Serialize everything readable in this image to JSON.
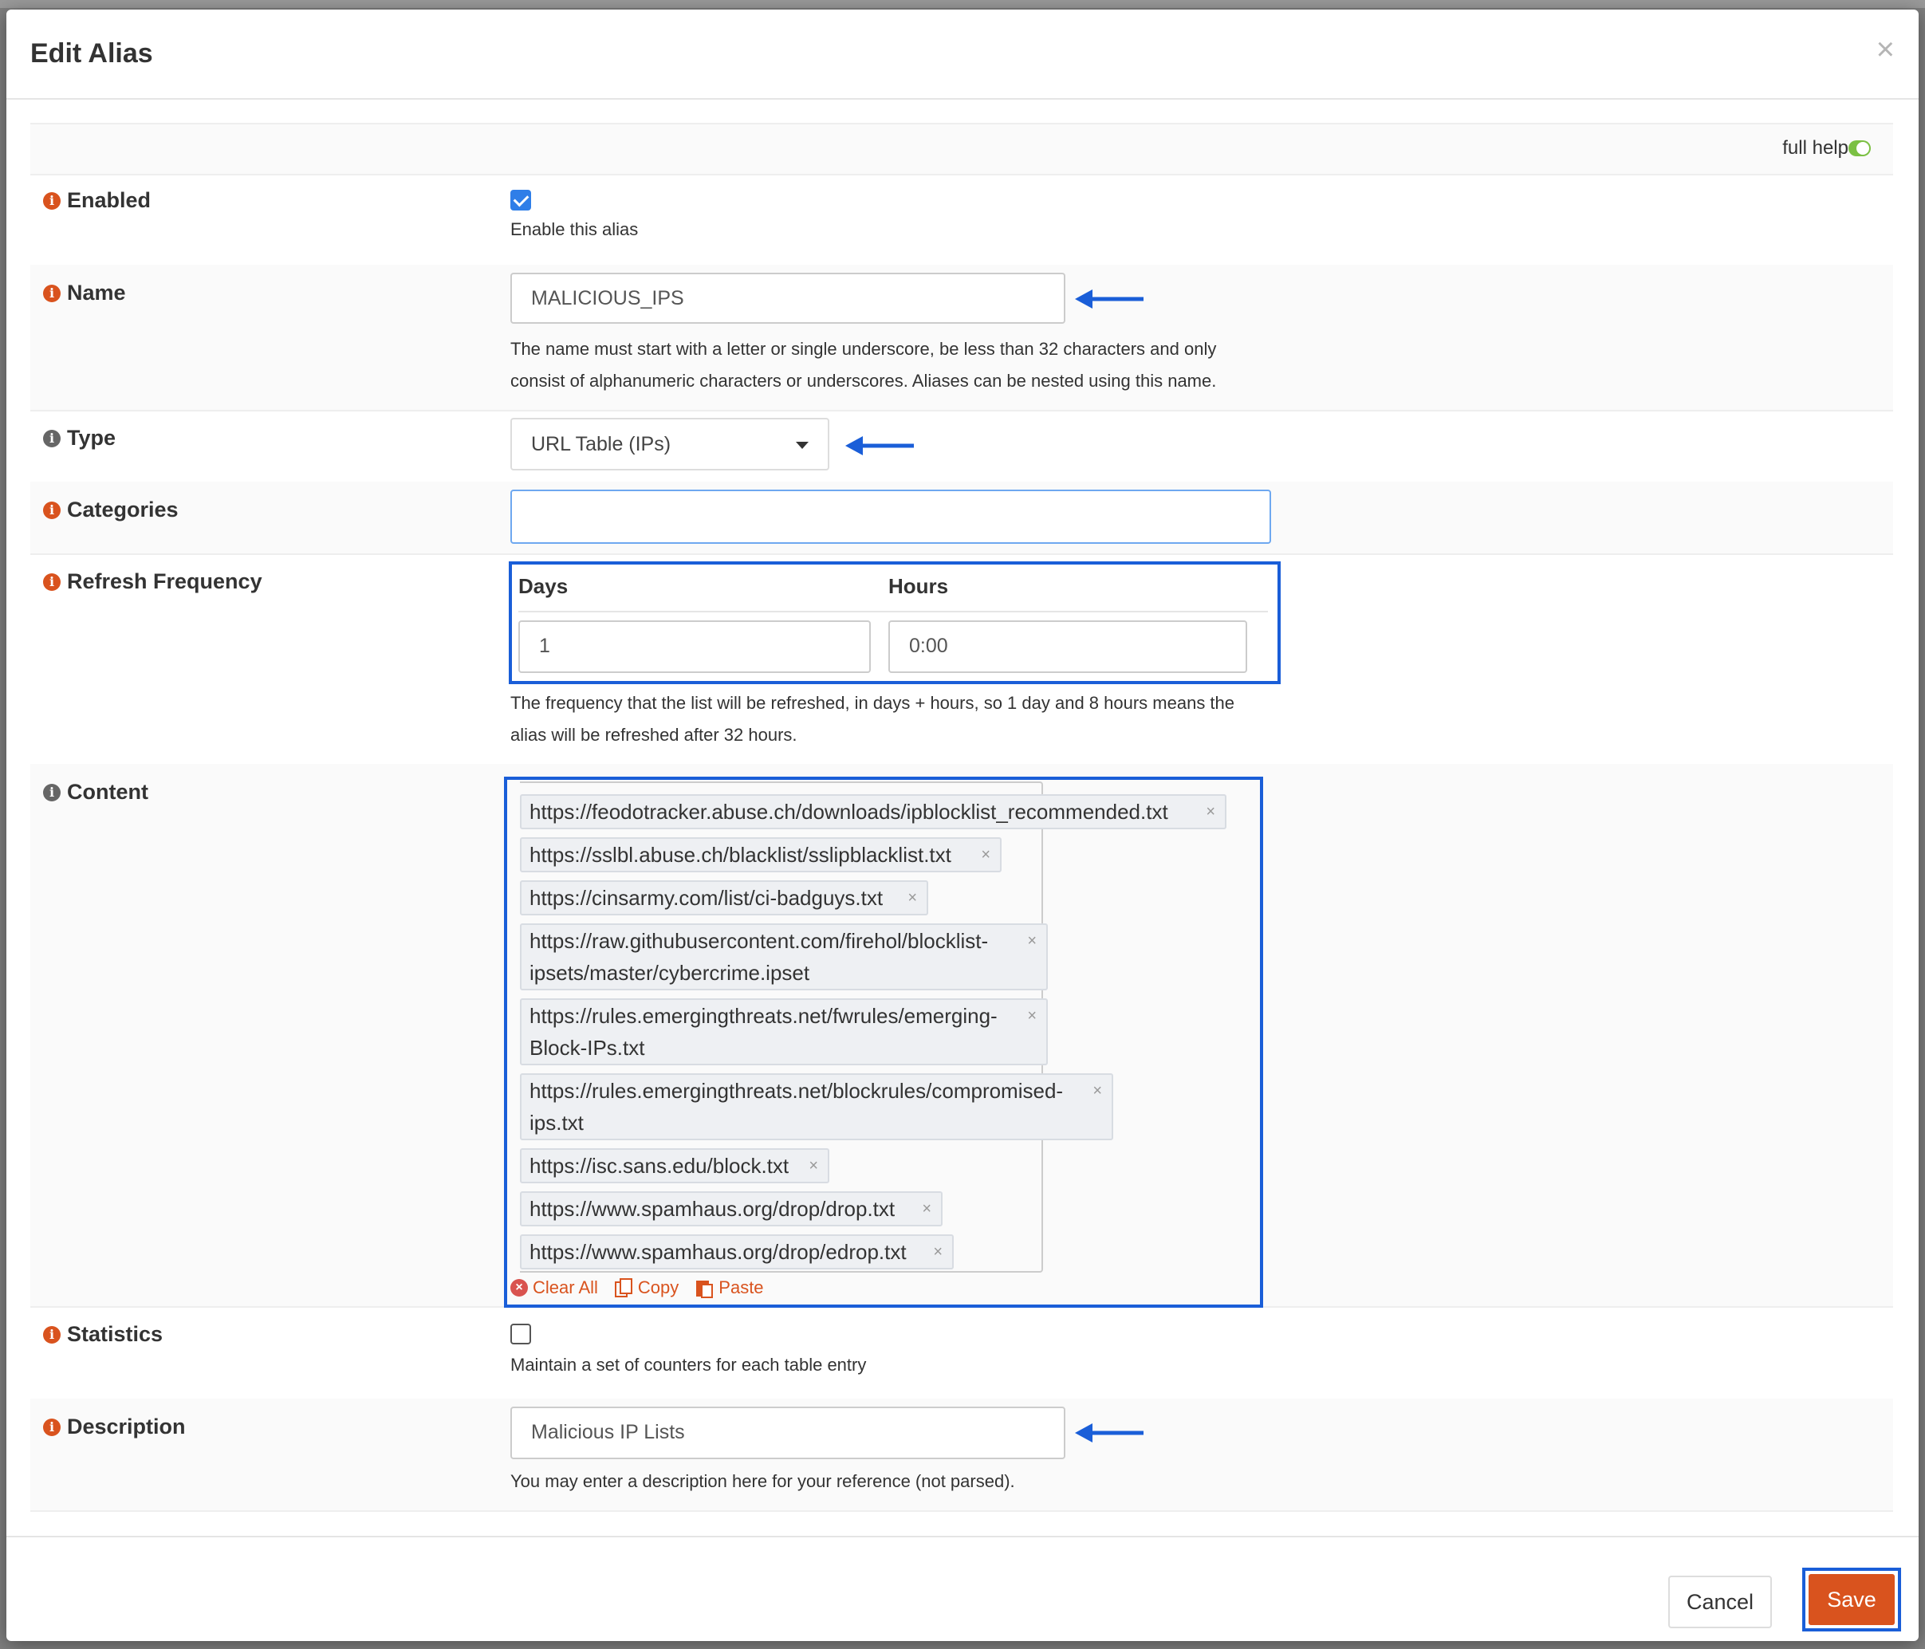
{
  "modal": {
    "title": "Edit Alias",
    "close_glyph": "×",
    "full_help_label": "full help"
  },
  "fields": {
    "enabled": {
      "label": "Enabled",
      "checked": true,
      "help": "Enable this alias"
    },
    "name": {
      "label": "Name",
      "value": "MALICIOUS_IPS",
      "help_line1": "The name must start with a letter or single underscore, be less than 32 characters and only",
      "help_line2": "consist of alphanumeric characters or underscores. Aliases can be nested using this name."
    },
    "type": {
      "label": "Type",
      "selected": "URL Table (IPs)"
    },
    "categories": {
      "label": "Categories",
      "value": ""
    },
    "refresh_frequency": {
      "label": "Refresh Frequency",
      "days_label": "Days",
      "hours_label": "Hours",
      "days_value": "1",
      "hours_value": "0:00",
      "help_line1": "The frequency that the list will be refreshed, in days + hours, so 1 day and 8 hours means the",
      "help_line2": "alias will be refreshed after 32 hours."
    },
    "content": {
      "label": "Content",
      "tags": [
        {
          "line1": "https://feodotracker.abuse.ch/downloads/ipblocklist_recommended.txt",
          "line2": ""
        },
        {
          "line1": "https://sslbl.abuse.ch/blacklist/sslipblacklist.txt",
          "line2": ""
        },
        {
          "line1": "https://cinsarmy.com/list/ci-badguys.txt",
          "line2": ""
        },
        {
          "line1": "https://raw.githubusercontent.com/firehol/blocklist-",
          "line2": "ipsets/master/cybercrime.ipset"
        },
        {
          "line1": "https://rules.emergingthreats.net/fwrules/emerging-",
          "line2": "Block-IPs.txt"
        },
        {
          "line1": "https://rules.emergingthreats.net/blockrules/compromised-",
          "line2": "ips.txt"
        },
        {
          "line1": "https://isc.sans.edu/block.txt",
          "line2": ""
        },
        {
          "line1": "https://www.spamhaus.org/drop/drop.txt",
          "line2": ""
        },
        {
          "line1": "https://www.spamhaus.org/drop/edrop.txt",
          "line2": ""
        }
      ],
      "tag_remove_glyph": "×",
      "actions": {
        "clear_all": "Clear All",
        "copy": "Copy",
        "paste": "Paste"
      }
    },
    "statistics": {
      "label": "Statistics",
      "checked": false,
      "help": "Maintain a set of counters for each table entry"
    },
    "description": {
      "label": "Description",
      "value": "Malicious IP Lists",
      "help": "You may enter a description here for your reference (not parsed)."
    }
  },
  "footer": {
    "cancel_label": "Cancel",
    "save_label": "Save"
  },
  "colors": {
    "accent": "#d9531e",
    "checkbox": "#2f7ee8",
    "annotation": "#1a5ed8",
    "toggle_on": "#7bc043"
  },
  "icons": {
    "info": "info-circle-icon",
    "close": "close-icon",
    "dropdown": "caret-down-icon",
    "annotation_arrow": "arrow-left-icon",
    "clear": "times-circle-icon",
    "copy": "copy-icon",
    "paste": "paste-icon"
  }
}
